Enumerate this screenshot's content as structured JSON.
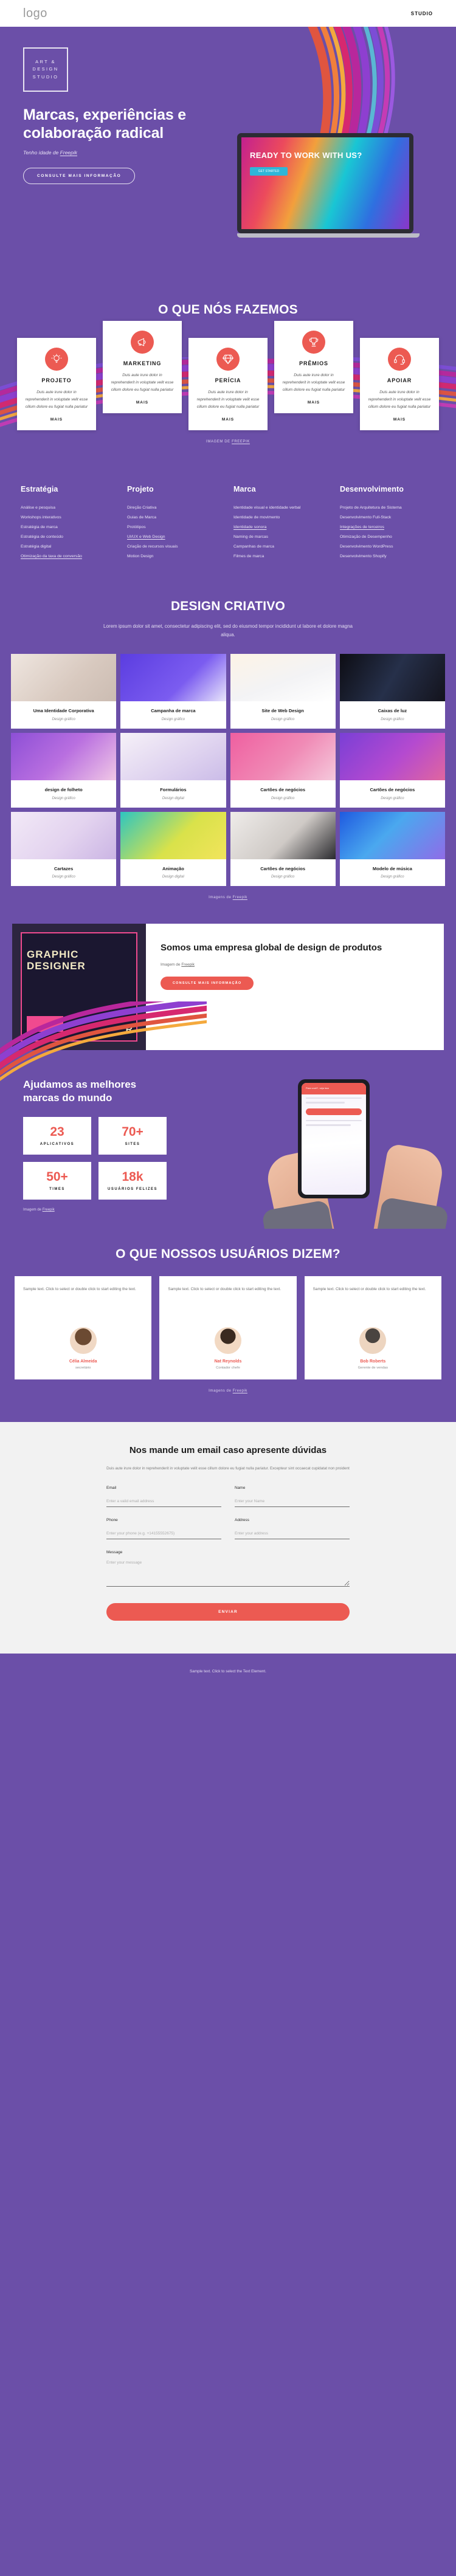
{
  "topbar": {
    "logo": "logo",
    "nav": "STUDIO"
  },
  "hero": {
    "badge_lines": [
      "ART &",
      "DESIGN",
      "STUDIO"
    ],
    "title": "Marcas, experiências e colaboração radical",
    "subtitle_prefix": "Tenho idade de ",
    "subtitle_link": "Freepik",
    "cta": "CONSULTE MAIS INFORMAÇÃO",
    "laptop_text": "READY TO WORK WITH US?",
    "laptop_button": "GET STARTED"
  },
  "services": {
    "title": "O QUE NÓS FAZEMOS",
    "credit_prefix": "IMAGEM DE ",
    "credit_link": "FREEPIK",
    "more_label": "MAIS",
    "cards": [
      {
        "name": "PROJETO",
        "icon": "lightbulb-icon",
        "desc": "Duis aute irure dolor in reprehenderit in voluptate velit esse cillum dolore eu fugiat nulla pariatur"
      },
      {
        "name": "MARKETING",
        "icon": "megaphone-icon",
        "desc": "Duis aute irure dolor in reprehenderit in voluptate velit esse cillum dolore eu fugiat nulla pariatur"
      },
      {
        "name": "PERÍCIA",
        "icon": "diamond-icon",
        "desc": "Duis aute irure dolor in reprehenderit in voluptate velit esse cillum dolore eu fugiat nulla pariatur"
      },
      {
        "name": "PRÊMIOS",
        "icon": "trophy-icon",
        "desc": "Duis aute irure dolor in reprehenderit in voluptate velit esse cillum dolore eu fugiat nulla pariatur"
      },
      {
        "name": "APOIAR",
        "icon": "headset-icon",
        "desc": "Duis aute irure dolor in reprehenderit in voluptate velit esse cillum dolore eu fugiat nulla pariatur"
      }
    ]
  },
  "lists": [
    {
      "heading": "Estratégia",
      "items": [
        {
          "label": "Análise e pesquisa",
          "link": false
        },
        {
          "label": "Workshops interativos",
          "link": false
        },
        {
          "label": "Estratégia de marca",
          "link": false
        },
        {
          "label": "Estratégia de conteúdo",
          "link": false
        },
        {
          "label": "Estratégia digital",
          "link": false
        },
        {
          "label": "Otimização da taxa de conversão",
          "link": true
        }
      ]
    },
    {
      "heading": "Projeto",
      "items": [
        {
          "label": "Direção Criativa",
          "link": false
        },
        {
          "label": "Guias de Marca",
          "link": false
        },
        {
          "label": "Protótipos",
          "link": false
        },
        {
          "label": "UI/UX e Web Design",
          "link": true
        },
        {
          "label": "Criação de recursos visuais",
          "link": false
        },
        {
          "label": "Motion Design",
          "link": false
        }
      ]
    },
    {
      "heading": "Marca",
      "items": [
        {
          "label": "Identidade visual e identidade verbal",
          "link": false
        },
        {
          "label": "Identidade de movimento",
          "link": false
        },
        {
          "label": "Identidade sonora",
          "link": true
        },
        {
          "label": "Naming de marcas",
          "link": false
        },
        {
          "label": "Campanhas de marca",
          "link": false
        },
        {
          "label": "Filmes de marca",
          "link": false
        }
      ]
    },
    {
      "heading": "Desenvolvimento",
      "items": [
        {
          "label": "Projeto de Arquitetura de Sistema",
          "link": false
        },
        {
          "label": "Desenvolvimento Full-Stack",
          "link": false
        },
        {
          "label": "Integrações de terceiros",
          "link": true
        },
        {
          "label": "Otimização de Desempenho",
          "link": false
        },
        {
          "label": "Desenvolvimento WordPress",
          "link": false
        },
        {
          "label": "Desenvolvimento Shopify",
          "link": false
        }
      ]
    }
  ],
  "portfolio": {
    "title": "DESIGN CRIATIVO",
    "subtitle": "Lorem ipsum dolor sit amet, consectetur adipiscing elit, sed do eiusmod tempor incididunt ut labore et dolore magna aliqua.",
    "credit_prefix": "Imagens de ",
    "credit_link": "Freepik",
    "items": [
      {
        "title": "Uma Identidade Corporativa",
        "sub": "Design gráfico",
        "thumb": "marble"
      },
      {
        "title": "Campanha de marca",
        "sub": "Design gráfico",
        "thumb": "bookcover"
      },
      {
        "title": "Site de Web Design",
        "sub": "Design gráfico",
        "thumb": "seo"
      },
      {
        "title": "Caixas de luz",
        "sub": "Design gráfico",
        "thumb": "neon"
      },
      {
        "title": "design de folheto",
        "sub": "Design gráfico",
        "thumb": "flyer"
      },
      {
        "title": "Formulários",
        "sub": "Design digital",
        "thumb": "mobileapp"
      },
      {
        "title": "Cartões de negócios",
        "sub": "Design gráfico",
        "thumb": "cards-pink"
      },
      {
        "title": "Cartões de negócios",
        "sub": "Design gráfico",
        "thumb": "cards-purple"
      },
      {
        "title": "Cartazes",
        "sub": "Design gráfico",
        "thumb": "posters"
      },
      {
        "title": "Animação",
        "sub": "Design digital",
        "thumb": "animation"
      },
      {
        "title": "Cartões de negócios",
        "sub": "Design gráfico",
        "thumb": "cards-dark"
      },
      {
        "title": "Modelo de música",
        "sub": "Design gráfico",
        "thumb": "music"
      }
    ]
  },
  "about": {
    "title": "Somos uma empresa global de design de produtos",
    "credit_prefix": "Imagem de ",
    "credit_link": "Freepik",
    "cta": "CONSULTE MAIS INFORMAÇÃO",
    "poster_text": "GRAPHIC DESIGNER"
  },
  "stats": {
    "title": "Ajudamos as melhores marcas do mundo",
    "credit_prefix": "Imagem de ",
    "credit_link": "Freepik",
    "items": [
      {
        "value": "23",
        "label": "APLICATIVOS"
      },
      {
        "value": "70+",
        "label": "SITES"
      },
      {
        "value": "50+",
        "label": "TIMES"
      },
      {
        "value": "18k",
        "label": "USUÁRIOS FELIZES"
      }
    ],
    "phone": {
      "heading": "Para você?, veja isso",
      "line": "Sample text. Click to select the Text Element."
    }
  },
  "testimonials": {
    "title": "O QUE NOSSOS USUÁRIOS DIZEM?",
    "credit_prefix": "Imagens de ",
    "credit_link": "Freepik",
    "items": [
      {
        "text": "Sample text. Click to select or double click to start editing the text.",
        "name": "Célia Almeida",
        "role": "secretário",
        "avatar": "woman-avatar"
      },
      {
        "text": "Sample text. Click to select or double click to start editing the text.",
        "name": "Nat Reynolds",
        "role": "Contador chefe",
        "avatar": "man-avatar"
      },
      {
        "text": "Sample text. Click to select or double click to start editing the text.",
        "name": "Bob Roberts",
        "role": "Gerente de vendas",
        "avatar": "man2-avatar"
      }
    ]
  },
  "contact": {
    "title": "Nos mande um email caso apresente dúvidas",
    "subtitle": "Duis aute irure dolor in reprehenderit in voluptate velit esse cillum dolore eu fugiat nulla pariatur. Excepteur sint occaecat cupidatat non proident",
    "fields": {
      "email_label": "Email",
      "email_placeholder": "Enter a valid email address",
      "name_label": "Name",
      "name_placeholder": "Enter your Name",
      "phone_label": "Phone",
      "phone_placeholder": "Enter your phone (e.g. +14155552675)",
      "address_label": "Address",
      "address_placeholder": "Enter your address",
      "message_label": "Message",
      "message_placeholder": "Enter your message"
    },
    "submit": "ENVIAR"
  },
  "footer": {
    "text": "Sample text. Click to select the Text Element."
  },
  "colors": {
    "purple": "#6b4fa8",
    "coral": "#ec5a52",
    "light": "#f2f2f2"
  }
}
